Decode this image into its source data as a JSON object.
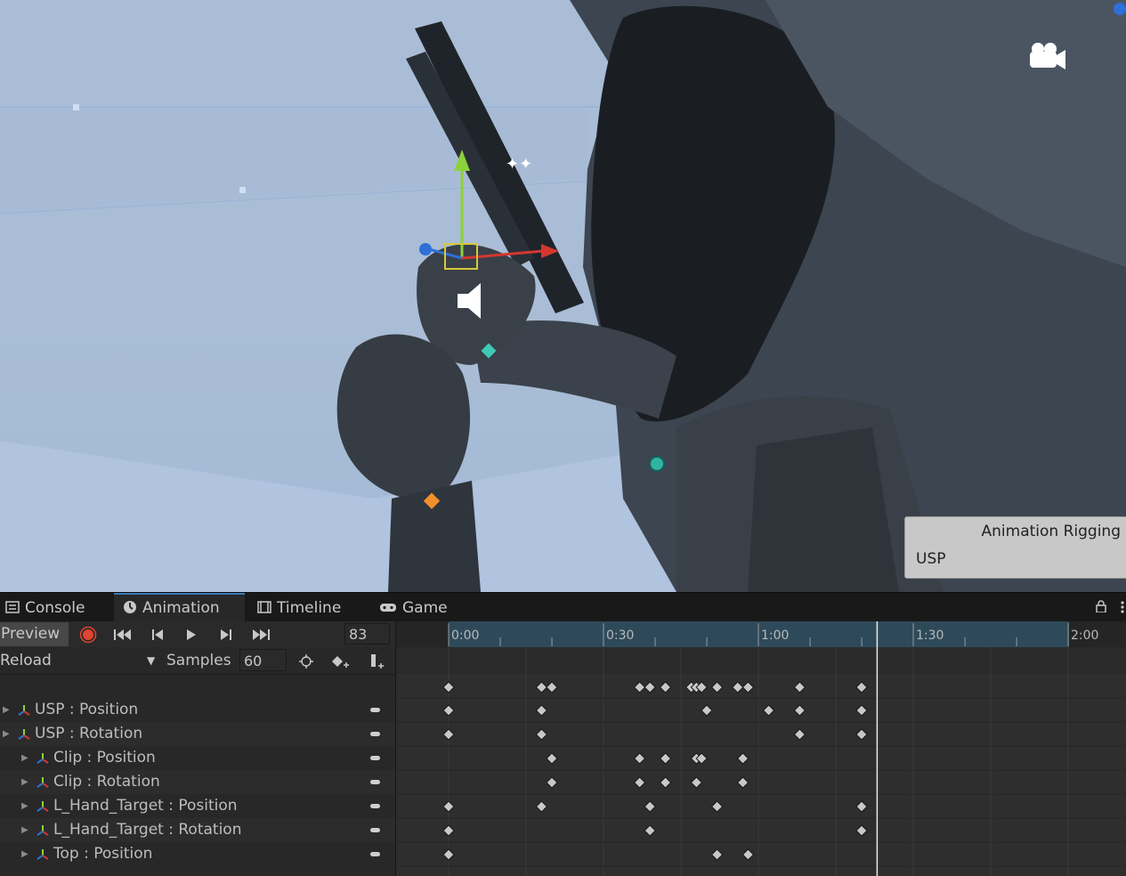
{
  "scene": {
    "overlay_title": "Animation Rigging",
    "overlay_subtitle": "USP"
  },
  "tabs": [
    {
      "label": "Console",
      "icon": "console-icon",
      "active": false
    },
    {
      "label": "Animation",
      "icon": "animation-clock-icon",
      "active": true
    },
    {
      "label": "Timeline",
      "icon": "timeline-film-icon",
      "active": false
    },
    {
      "label": "Game",
      "icon": "gamepad-icon",
      "active": false
    }
  ],
  "toolbar": {
    "preview_label": "Preview",
    "current_frame": "83",
    "clip_name": "Reload",
    "samples_label": "Samples",
    "samples_value": "60"
  },
  "properties": [
    {
      "label": "USP : Position",
      "indent": 0,
      "keys": [
        0.0,
        0.3,
        0.8333,
        1.0333,
        1.1333,
        1.3333
      ]
    },
    {
      "label": "USP : Rotation",
      "indent": 0,
      "keys": [
        0.0,
        0.3,
        1.1333,
        1.3333
      ]
    },
    {
      "label": "Clip : Position",
      "indent": 1,
      "keys": [
        0.3333,
        0.6167,
        0.7,
        0.8,
        0.8167,
        0.95
      ]
    },
    {
      "label": "Clip : Rotation",
      "indent": 1,
      "keys": [
        0.3333,
        0.6167,
        0.7,
        0.8,
        0.95
      ]
    },
    {
      "label": "L_Hand_Target : Position",
      "indent": 1,
      "keys": [
        0.0,
        0.3,
        0.65,
        0.8667,
        1.3333
      ]
    },
    {
      "label": "L_Hand_Target : Rotation",
      "indent": 1,
      "keys": [
        0.0,
        0.65,
        1.3333
      ]
    },
    {
      "label": "Top : Position",
      "indent": 1,
      "keys": [
        0.0,
        0.8667,
        0.9667
      ]
    }
  ],
  "summary_keys": [
    0.0,
    0.3,
    0.3333,
    0.6167,
    0.65,
    0.7,
    0.7833,
    0.8,
    0.8167,
    0.8667,
    0.9333,
    0.9667,
    1.1333,
    1.3333
  ],
  "timeline": {
    "tick_labels": [
      "0:00",
      "0:30",
      "1:00",
      "1:30",
      "2:00"
    ],
    "playhead_frame": 83,
    "colors": {
      "clip_region": "#2e4a5a",
      "keyframe": "#c8c8c8",
      "playhead": "#e8e8e8",
      "record": "#e0452f"
    }
  }
}
